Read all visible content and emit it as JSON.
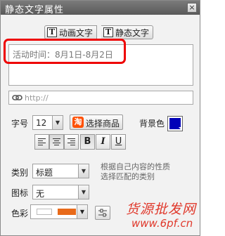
{
  "window": {
    "title": "静态文字属性",
    "close_label": "×"
  },
  "mode_tabs": [
    {
      "label": "动画文字",
      "icon": "text-type-icon",
      "glyph": "T",
      "selected": false
    },
    {
      "label": "静态文字",
      "icon": "text-type-icon",
      "glyph": "T",
      "selected": true
    }
  ],
  "text_content": "活动时间：8月1日-8月2日",
  "link": {
    "icon": "link-icon",
    "placeholder": "http://"
  },
  "font_size": {
    "label": "字号",
    "value": "12"
  },
  "select_goods": {
    "label": "选择商品",
    "icon_glyph": "淘",
    "icon": "taobao-icon"
  },
  "background_color": {
    "label": "背景色",
    "value": "#0000b8"
  },
  "format_buttons": [
    {
      "name": "align-left",
      "glyph": "",
      "active": false
    },
    {
      "name": "align-center",
      "glyph": "",
      "active": true
    },
    {
      "name": "align-right",
      "glyph": "",
      "active": false
    },
    {
      "name": "bold",
      "glyph": "B",
      "active": true
    },
    {
      "name": "italic",
      "glyph": "I",
      "active": false
    },
    {
      "name": "underline",
      "glyph": "U",
      "active": false
    }
  ],
  "category": {
    "label": "类别",
    "value": "标题",
    "hint_line1": "根据自己内容的性质",
    "hint_line2": "选择匹配的类别"
  },
  "icon_select": {
    "label": "图标",
    "value": "无"
  },
  "colors": {
    "label": "色彩",
    "color1": "#ffffff",
    "color2": "#e86a1a"
  },
  "watermark": {
    "line1": "货源批发网",
    "line2": "www.6pf.cn"
  }
}
